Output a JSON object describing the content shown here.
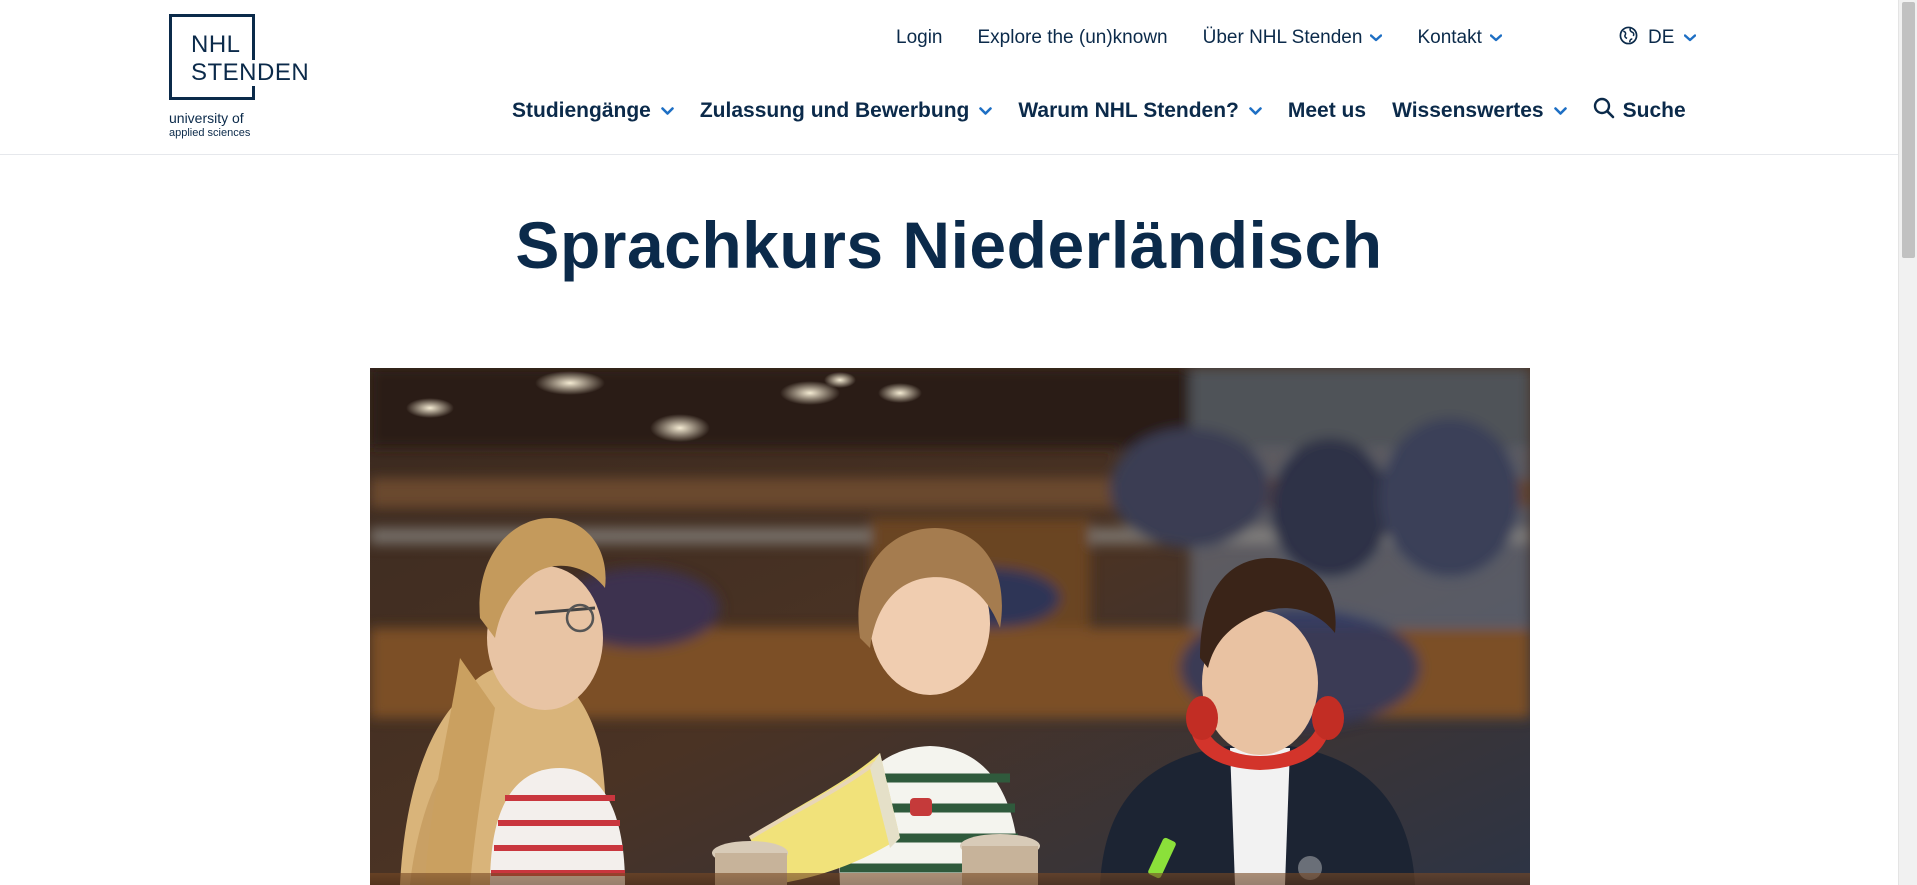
{
  "logo": {
    "wordmark_line1": "NHL",
    "wordmark_line2": "STENDEN",
    "subtitle_line1": "university of",
    "subtitle_line2": "applied sciences"
  },
  "util_nav": {
    "items": [
      {
        "label": "Login"
      },
      {
        "label": "Explore the (un)known"
      },
      {
        "label": "Über NHL Stenden"
      },
      {
        "label": "Kontakt"
      }
    ],
    "language": "DE"
  },
  "main_nav": {
    "items": [
      {
        "label": "Studiengänge"
      },
      {
        "label": "Zulassung und Bewerbung"
      },
      {
        "label": "Warum NHL Stenden?"
      },
      {
        "label": "Meet us"
      },
      {
        "label": "Wissenswertes"
      }
    ],
    "search_label": "Suche"
  },
  "page": {
    "title": "Sprachkurs Niederländisch"
  },
  "colors": {
    "brand_navy": "#0b2a4a",
    "accent_blue": "#1e6fc4"
  }
}
